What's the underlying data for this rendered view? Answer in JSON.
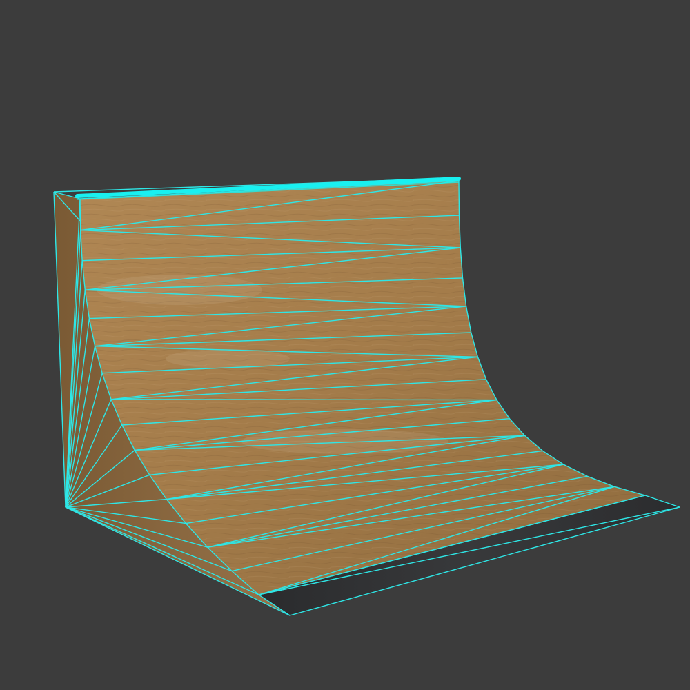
{
  "scene": {
    "background_color": "#3c3c3c",
    "wood_light": "#b38a56",
    "wood_mid": "#a17a48",
    "wood_dark": "#7d5a33",
    "side_panel_color": "#8a6840",
    "wireframe_color": "#2ee6e6",
    "coping_color": "#19f0f0",
    "metal_plate_color": "#2c2d2f"
  },
  "objects": [
    {
      "name": "quarter-pipe-ramp",
      "icon": "ramp-model"
    }
  ]
}
